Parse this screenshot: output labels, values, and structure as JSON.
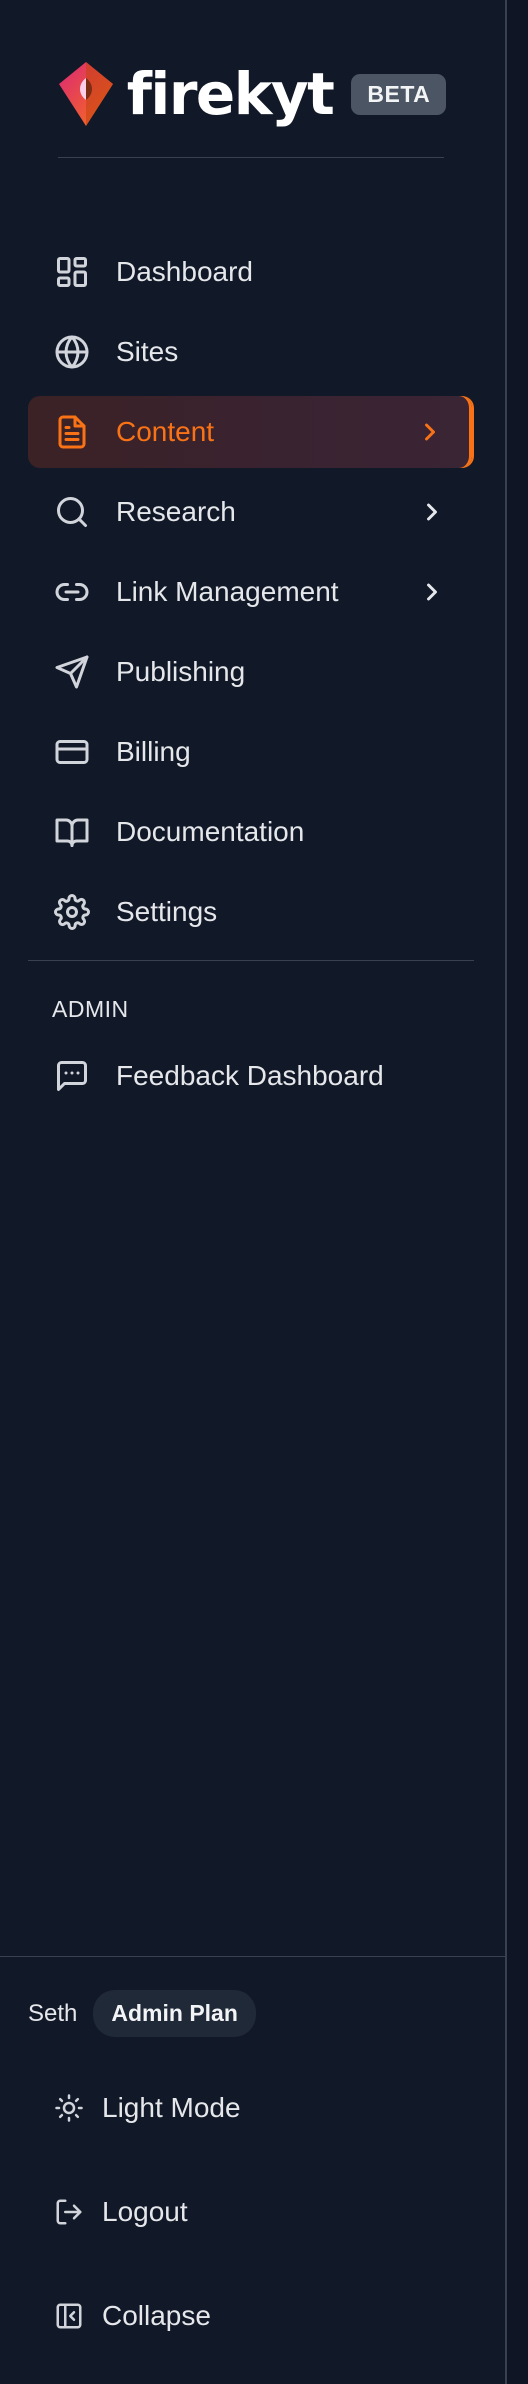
{
  "brand": {
    "name": "firekyt",
    "badge": "BETA",
    "accent": "#f97316"
  },
  "nav": {
    "items": [
      {
        "label": "Dashboard",
        "icon": "dashboard-icon"
      },
      {
        "label": "Sites",
        "icon": "globe-icon"
      },
      {
        "label": "Content",
        "icon": "document-icon",
        "active": true,
        "has_submenu": true
      },
      {
        "label": "Research",
        "icon": "search-icon",
        "has_submenu": true
      },
      {
        "label": "Link Management",
        "icon": "link-icon",
        "has_submenu": true
      },
      {
        "label": "Publishing",
        "icon": "send-icon"
      },
      {
        "label": "Billing",
        "icon": "credit-card-icon"
      },
      {
        "label": "Documentation",
        "icon": "book-icon"
      },
      {
        "label": "Settings",
        "icon": "gear-icon"
      }
    ]
  },
  "admin": {
    "section_label": "ADMIN",
    "items": [
      {
        "label": "Feedback Dashboard",
        "icon": "message-square-icon"
      }
    ]
  },
  "user": {
    "name": "Seth",
    "plan": "Admin Plan"
  },
  "footer": {
    "light_mode_label": "Light Mode",
    "logout_label": "Logout",
    "collapse_label": "Collapse"
  }
}
